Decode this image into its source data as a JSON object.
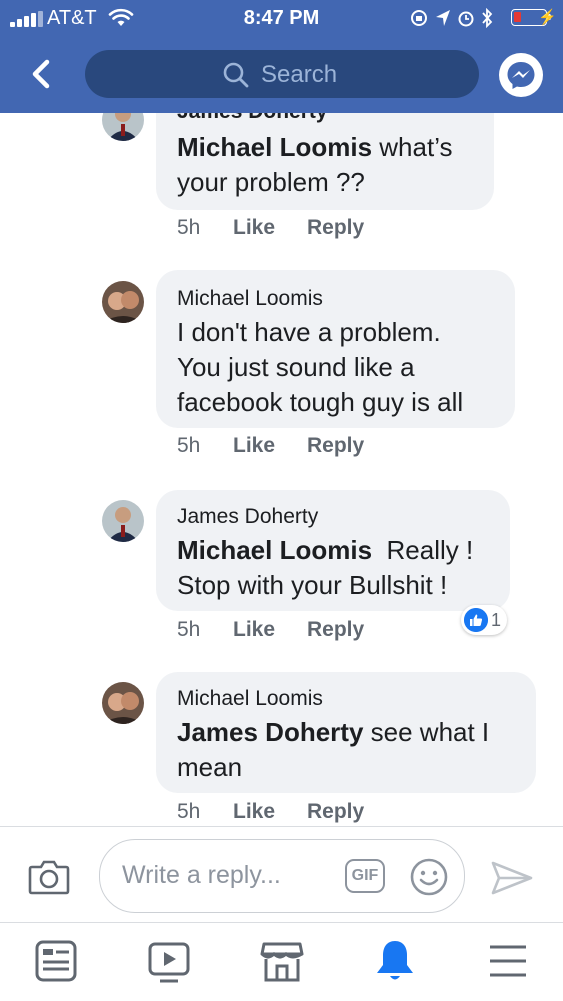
{
  "status_bar": {
    "carrier": "AT&T",
    "time": "8:47 PM"
  },
  "header": {
    "search_placeholder": "Search"
  },
  "comments": [
    {
      "author": "James Doherty",
      "mention": "Michael Loomis",
      "text_lines": [
        " what’s",
        "your problem ??"
      ],
      "time": "5h",
      "like_label": "Like",
      "reply_label": "Reply"
    },
    {
      "author": "Michael Loomis",
      "text_lines": [
        "I don't have a problem.",
        "You just sound like a",
        "facebook tough guy is all"
      ],
      "time": "5h",
      "like_label": "Like",
      "reply_label": "Reply"
    },
    {
      "author": "James Doherty",
      "mention": "Michael Loomis",
      "text_lines": "  Really !",
      "text_line2": "Stop with your Bullshit !",
      "time": "5h",
      "like_label": "Like",
      "reply_label": "Reply",
      "reaction_count": "1"
    },
    {
      "author": "Michael Loomis",
      "mention": "James Doherty",
      "text_lines": " see what I",
      "text_line2": "mean",
      "time": "5h",
      "like_label": "Like",
      "reply_label": "Reply"
    }
  ],
  "reply_bar": {
    "placeholder": "Write a reply...",
    "gif_label": "GIF"
  },
  "colors": {
    "brand": "#4267b2",
    "bubble": "#f0f2f5",
    "like_blue": "#1877f2",
    "active_tab": "#1877f2"
  },
  "tabs": [
    "news-feed-icon",
    "watch-icon",
    "marketplace-icon",
    "notifications-icon",
    "menu-icon"
  ]
}
